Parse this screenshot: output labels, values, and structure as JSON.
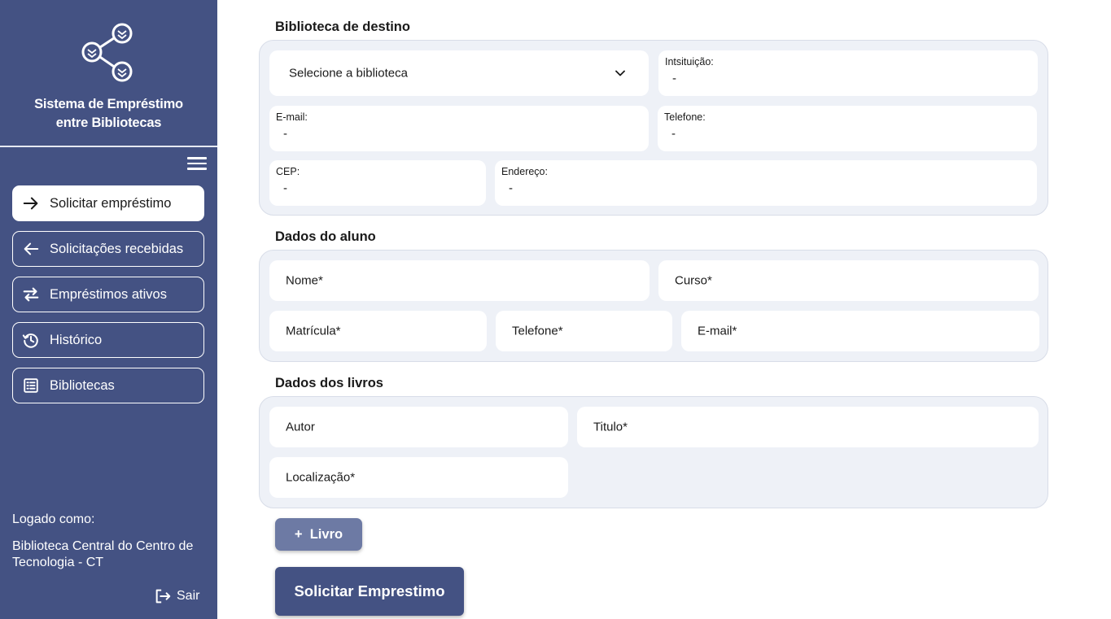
{
  "sidebar": {
    "app_title_line1": "Sistema de Empréstimo",
    "app_title_line2": "entre Bibliotecas",
    "items": [
      {
        "label": "Solicitar empréstimo",
        "icon": "arrow-right-icon",
        "active": true
      },
      {
        "label": "Solicitações recebidas",
        "icon": "arrow-left-icon",
        "active": false
      },
      {
        "label": "Empréstimos ativos",
        "icon": "swap-arrows-icon",
        "active": false
      },
      {
        "label": "Histórico",
        "icon": "history-icon",
        "active": false
      },
      {
        "label": "Bibliotecas",
        "icon": "list-icon",
        "active": false
      }
    ],
    "logged_label": "Logado como:",
    "logged_name": "Biblioteca Central do Centro de Tecnologia - CT",
    "logout_label": "Sair"
  },
  "destination": {
    "title": "Biblioteca de destino",
    "select_placeholder": "Selecione a biblioteca",
    "institution_label": "Intsituição:",
    "institution_value": "-",
    "email_label": "E-mail:",
    "email_value": "-",
    "phone_label": "Telefone:",
    "phone_value": "-",
    "cep_label": "CEP:",
    "cep_value": "-",
    "address_label": "Endereço:",
    "address_value": "-"
  },
  "student": {
    "title": "Dados do aluno",
    "name_placeholder": "Nome*",
    "course_placeholder": "Curso*",
    "registration_placeholder": "Matrícula*",
    "phone_placeholder": "Telefone*",
    "email_placeholder": "E-mail*"
  },
  "books": {
    "title": "Dados dos livros",
    "author_placeholder": "Autor",
    "title_placeholder": "Titulo*",
    "location_placeholder": "Localização*"
  },
  "actions": {
    "add_book_label": "+  Livro",
    "submit_label": "Solicitar Emprestimo"
  },
  "colors": {
    "sidebar_bg": "#445283",
    "panel_bg": "#eef1f7",
    "add_button_bg": "#6d7aa4",
    "submit_button_bg": "#445283"
  }
}
